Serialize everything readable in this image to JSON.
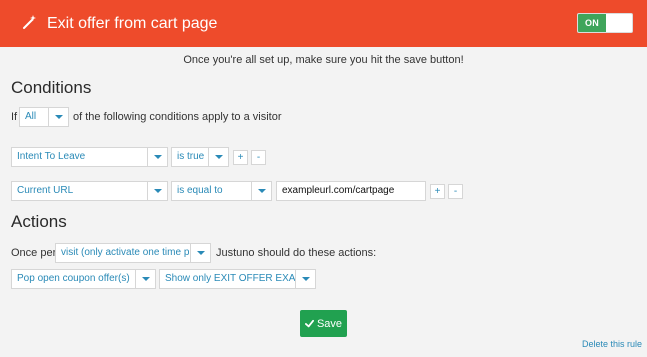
{
  "header": {
    "title": "Exit offer from cart page",
    "toggle_label": "ON",
    "wand_icon": "magic-wand-icon"
  },
  "note": "Once you're all set up, make sure you hit the save button!",
  "conditions": {
    "title": "Conditions",
    "prefix": "If",
    "match_value": "All",
    "suffix": "of the following conditions apply to a visitor",
    "rows": [
      {
        "field": "Intent To Leave",
        "operator": "is true",
        "value": ""
      },
      {
        "field": "Current URL",
        "operator": "is equal to",
        "value": "exampleurl.com/cartpage"
      }
    ],
    "add_label": "+",
    "remove_label": "-"
  },
  "actions": {
    "title": "Actions",
    "prefix": "Once per",
    "frequency": "visit (only activate one time pe",
    "suffix": "Justuno should do these actions:",
    "action": "Pop open coupon offer(s)",
    "offer": "Show only EXIT OFFER EXAMI"
  },
  "footer": {
    "save_label": "Save",
    "delete_label": "Delete this rule"
  },
  "colors": {
    "header_bg": "#ee4b2b",
    "toggle_on": "#3fa55b",
    "save_bg": "#21a150",
    "link": "#2a8ab7"
  }
}
